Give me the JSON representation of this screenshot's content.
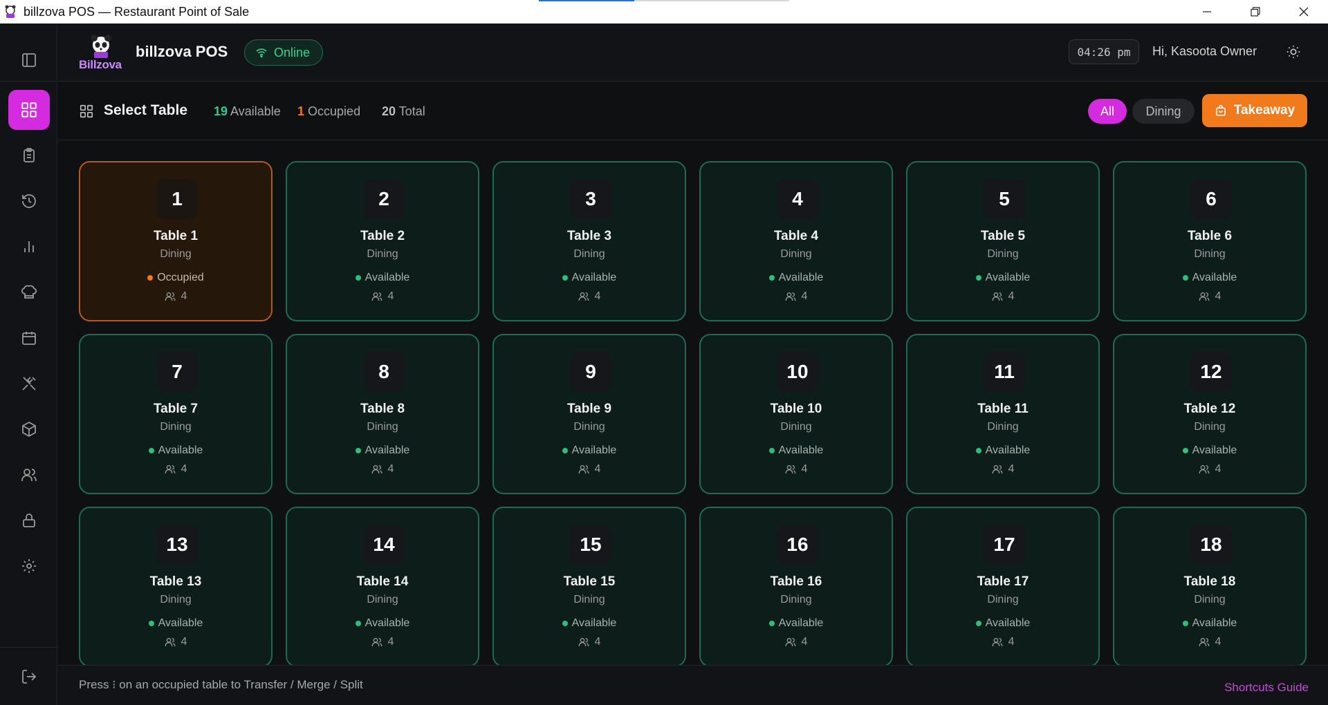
{
  "window": {
    "title": "billzova POS — Restaurant Point of Sale",
    "load_progress": 0.38
  },
  "header": {
    "logo_text": "Billzova",
    "brand": "billzova POS",
    "status": "Online",
    "time": "04:26 pm",
    "greeting": "Hi, Kasoota Owner"
  },
  "sidebar": {
    "items": [
      {
        "icon": "tables-grid-icon",
        "active": true
      },
      {
        "icon": "orders-clipboard-icon"
      },
      {
        "icon": "history-icon"
      },
      {
        "icon": "reports-chart-icon"
      },
      {
        "icon": "kitchen-chef-icon"
      },
      {
        "icon": "calendar-icon"
      },
      {
        "icon": "menu-utensils-icon"
      },
      {
        "icon": "inventory-box-icon"
      },
      {
        "icon": "staff-users-icon"
      },
      {
        "icon": "lock-icon"
      },
      {
        "icon": "settings-gear-icon"
      }
    ],
    "logout_icon": "logout-icon"
  },
  "toolbar": {
    "title": "Select Table",
    "available_count": "19",
    "available_label": "Available",
    "occupied_count": "1",
    "occupied_label": "Occupied",
    "total_count": "20",
    "total_label": "Total",
    "filter_all": "All",
    "filter_dining": "Dining",
    "takeaway": "Takeaway"
  },
  "tables": [
    {
      "number": "1",
      "name": "Table 1",
      "type": "Dining",
      "status": "Occupied",
      "seats": "4"
    },
    {
      "number": "2",
      "name": "Table 2",
      "type": "Dining",
      "status": "Available",
      "seats": "4"
    },
    {
      "number": "3",
      "name": "Table 3",
      "type": "Dining",
      "status": "Available",
      "seats": "4"
    },
    {
      "number": "4",
      "name": "Table 4",
      "type": "Dining",
      "status": "Available",
      "seats": "4"
    },
    {
      "number": "5",
      "name": "Table 5",
      "type": "Dining",
      "status": "Available",
      "seats": "4"
    },
    {
      "number": "6",
      "name": "Table 6",
      "type": "Dining",
      "status": "Available",
      "seats": "4"
    },
    {
      "number": "7",
      "name": "Table 7",
      "type": "Dining",
      "status": "Available",
      "seats": "4"
    },
    {
      "number": "8",
      "name": "Table 8",
      "type": "Dining",
      "status": "Available",
      "seats": "4"
    },
    {
      "number": "9",
      "name": "Table 9",
      "type": "Dining",
      "status": "Available",
      "seats": "4"
    },
    {
      "number": "10",
      "name": "Table 10",
      "type": "Dining",
      "status": "Available",
      "seats": "4"
    },
    {
      "number": "11",
      "name": "Table 11",
      "type": "Dining",
      "status": "Available",
      "seats": "4"
    },
    {
      "number": "12",
      "name": "Table 12",
      "type": "Dining",
      "status": "Available",
      "seats": "4"
    },
    {
      "number": "13",
      "name": "Table 13",
      "type": "Dining",
      "status": "Available",
      "seats": "4"
    },
    {
      "number": "14",
      "name": "Table 14",
      "type": "Dining",
      "status": "Available",
      "seats": "4"
    },
    {
      "number": "15",
      "name": "Table 15",
      "type": "Dining",
      "status": "Available",
      "seats": "4"
    },
    {
      "number": "16",
      "name": "Table 16",
      "type": "Dining",
      "status": "Available",
      "seats": "4"
    },
    {
      "number": "17",
      "name": "Table 17",
      "type": "Dining",
      "status": "Available",
      "seats": "4"
    },
    {
      "number": "18",
      "name": "Table 18",
      "type": "Dining",
      "status": "Available",
      "seats": "4"
    }
  ],
  "footer": {
    "hint": "Press ⁝ on an occupied table to Transfer / Merge / Split",
    "shortcuts": "Shortcuts Guide"
  },
  "colors": {
    "accent": "#d42be0",
    "available": "#2fbf7c",
    "occupied": "#f07a1c",
    "takeaway": "#f07a1c"
  }
}
